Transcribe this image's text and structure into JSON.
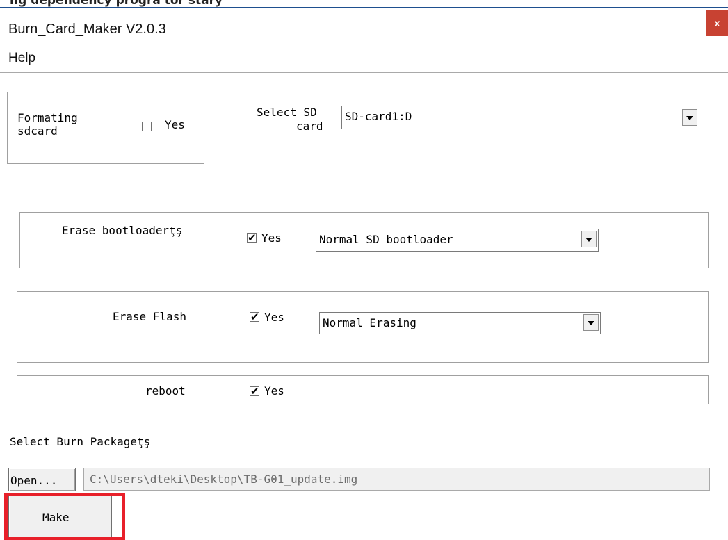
{
  "window": {
    "title": "Burn_Card_Maker V2.0.3",
    "close_glyph": "x",
    "top_strip_text": "ng  dependency  progra  tor  stary"
  },
  "menu": {
    "help": "Help"
  },
  "format_group": {
    "label_line1": "Formating",
    "label_line2": "sdcard",
    "checked": false,
    "check_label": "Yes"
  },
  "sd_select": {
    "label_line1": "Select SD",
    "label_line2": "card",
    "value": "SD-card1:D"
  },
  "erase_boot": {
    "label": "Erase bootloaderţş",
    "checked": true,
    "check_label": "Yes",
    "value": "Normal SD bootloader"
  },
  "erase_flash": {
    "label": "Erase Flash",
    "checked": true,
    "check_label": "Yes",
    "value": "Normal Erasing"
  },
  "reboot": {
    "label": "reboot",
    "checked": true,
    "check_label": "Yes"
  },
  "package": {
    "label": "Select Burn Packageţş",
    "open_label": "Open...",
    "path": "C:\\Users\\dteki\\Desktop\\TB-G01_update.img"
  },
  "make": {
    "label": "Make"
  },
  "checkmark": "✔",
  "colors": {
    "close_bg": "#c84232",
    "highlight": "#e8202a",
    "top_line": "#1e4f8f"
  }
}
